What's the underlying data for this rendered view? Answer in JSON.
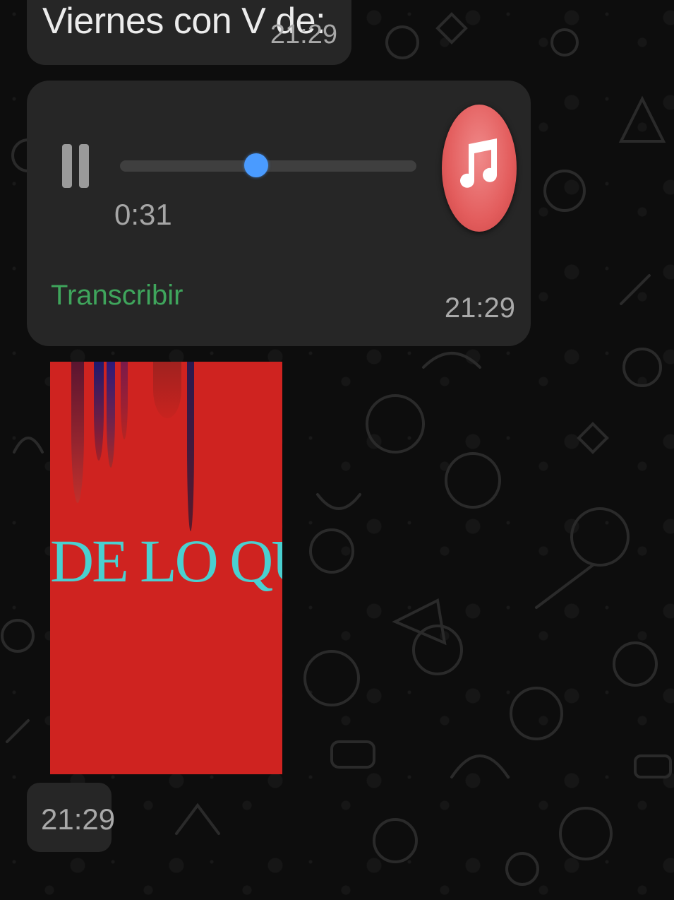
{
  "messages": {
    "text_bubble": {
      "text": "Viernes con V de:",
      "time": "21:29"
    },
    "audio_bubble": {
      "elapsed": "0:31",
      "progress_fraction": 0.46,
      "transcribe_label": "Transcribir",
      "time": "21:29",
      "state": "playing",
      "pause_icon": "pause-icon",
      "avatar_icon": "music-note-icon"
    },
    "image_bubble": {
      "poster_text": "DE LO QUE",
      "time": "21:29"
    }
  },
  "colors": {
    "bubble": "#262626",
    "accent_blue": "#4a9bff",
    "transcribe_green": "#3fa55c",
    "poster_red": "#cf2320",
    "poster_text_cyan": "#4ad0d0",
    "music_avatar": "#e35d5d"
  }
}
